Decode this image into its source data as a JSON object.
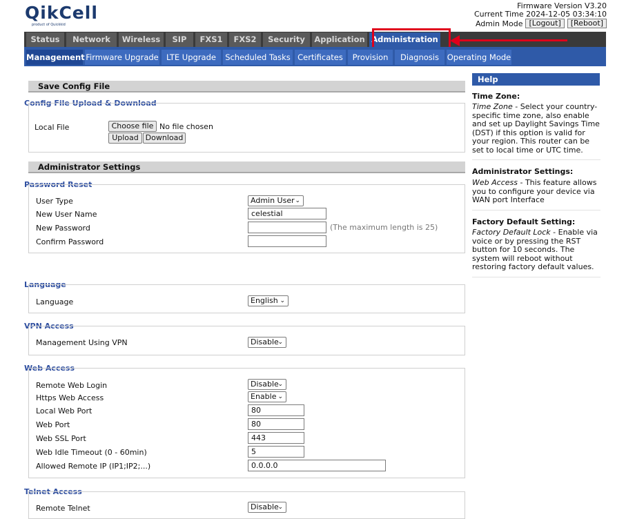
{
  "brand": {
    "name": "QikCell",
    "tagline": "product of Quickkid"
  },
  "header": {
    "firmware": "Firmware Version V3.20",
    "current_time": "Current Time 2024-12-05 03:34:10",
    "mode": "Admin Mode",
    "logout": "[Logout]",
    "reboot": "[Reboot]"
  },
  "main_tabs": [
    "Status",
    "Network",
    "Wireless",
    "SIP",
    "FXS1",
    "FXS2",
    "Security",
    "Application",
    "Administration"
  ],
  "sub_tabs": [
    "Management",
    "Firmware Upgrade",
    "LTE Upgrade",
    "Scheduled Tasks",
    "Certificates",
    "Provision",
    "Diagnosis",
    "Operating Mode"
  ],
  "save_config": {
    "title": "Save Config File",
    "group": "Config File Upload & Download",
    "local_file_label": "Local File",
    "choose_file": "Choose file",
    "no_file": "No file chosen",
    "upload": "Upload",
    "download": "Download"
  },
  "admin": {
    "title": "Administrator Settings",
    "password_reset": "Password Reset",
    "user_type_label": "User Type",
    "user_type_value": "Admin User",
    "new_user_label": "New User Name",
    "new_user_value": "celestial",
    "new_password_label": "New Password",
    "new_password_value": "",
    "max_len_hint": "(The maximum length is 25)",
    "confirm_password_label": "Confirm Password",
    "confirm_password_value": ""
  },
  "language": {
    "group": "Language",
    "label": "Language",
    "value": "English"
  },
  "vpn": {
    "group": "VPN Access",
    "label": "Management Using VPN",
    "value": "Disable"
  },
  "web": {
    "group": "Web Access",
    "remote_login_label": "Remote Web Login",
    "remote_login_value": "Disable",
    "https_label": "Https Web Access",
    "https_value": "Enable",
    "local_port_label": "Local Web Port",
    "local_port_value": "80",
    "web_port_label": "Web Port",
    "web_port_value": "80",
    "ssl_port_label": "Web SSL Port",
    "ssl_port_value": "443",
    "idle_label": "Web Idle Timeout (0 - 60min)",
    "idle_value": "5",
    "allowed_ip_label": "Allowed Remote IP (IP1;IP2;...)",
    "allowed_ip_value": "0.0.0.0"
  },
  "telnet": {
    "group": "Telnet Access",
    "label": "Remote Telnet",
    "value": "Disable"
  },
  "help": {
    "title": "Help",
    "tz_h": "Time Zone:",
    "tz_em": "Time Zone",
    "tz_text": " - Select your country-specific time zone, also enable and set up Daylight Savings Time (DST) if this option is valid for your region. This router can be set to local time or UTC time.",
    "admin_h": "Administrator Settings:",
    "admin_em": "Web Access",
    "admin_text": " - This feature allows you to configure your device via WAN port Interface",
    "factory_h": "Factory Default Setting:",
    "factory_em": "Factory Default Lock",
    "factory_text": " - Enable via voice or by pressing the RST button for 10 seconds. The system will reboot without restoring factory default values."
  },
  "colors": {
    "nav_dark": "#3a3a3a",
    "nav_tab": "#5a5a5a",
    "accent_blue": "#2f5aa8",
    "highlight_red": "#e0001b"
  }
}
